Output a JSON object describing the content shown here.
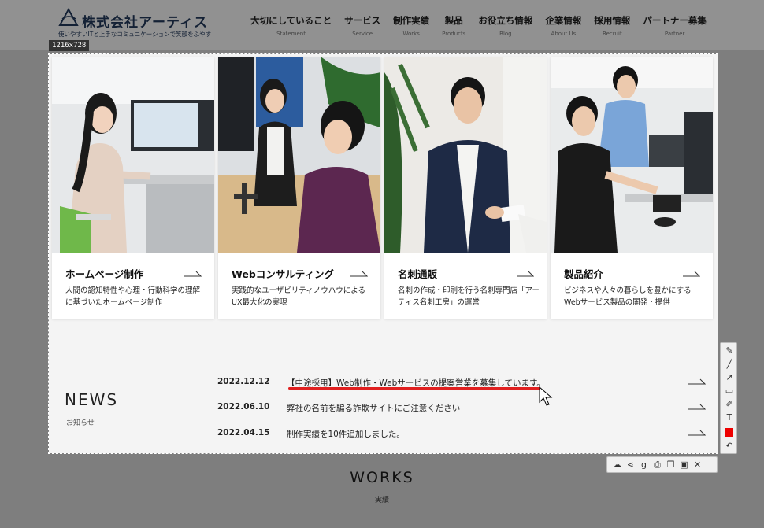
{
  "header": {
    "logo_text": "株式会社アーティス",
    "logo_tagline": "使いやすいITと上手なコミュニケーションで笑顔をふやす",
    "nav": [
      {
        "label": "大切にしていること",
        "sub": "Statement"
      },
      {
        "label": "サービス",
        "sub": "Service"
      },
      {
        "label": "制作実績",
        "sub": "Works"
      },
      {
        "label": "製品",
        "sub": "Products"
      },
      {
        "label": "お役立ち情報",
        "sub": "Blog"
      },
      {
        "label": "企業情報",
        "sub": "About Us"
      },
      {
        "label": "採用情報",
        "sub": "Recruit"
      },
      {
        "label": "パートナー募集",
        "sub": "Partner"
      }
    ]
  },
  "selection": {
    "size_label": "1216x728"
  },
  "cards": [
    {
      "title": "ホームページ制作",
      "desc": "人間の認知特性や心理・行動科学の理解に基づいたホームページ制作"
    },
    {
      "title": "Webコンサルティング",
      "desc": "実践的なユーザビリティノウハウによるUX最大化の実現"
    },
    {
      "title": "名刺通販",
      "desc": "名刺の作成・印刷を行う名刺専門店「アーティス名刺工房」の運営"
    },
    {
      "title": "製品紹介",
      "desc": "ビジネスや人々の暮らしを豊かにするWebサービス製品の開発・提供"
    }
  ],
  "news": {
    "heading": "NEWS",
    "sub": "お知らせ",
    "items": [
      {
        "date": "2022.12.12",
        "title": "【中途採用】Web制作・Webサービスの提案営業を募集しています。"
      },
      {
        "date": "2022.06.10",
        "title": "弊社の名前を騙る詐欺サイトにご注意ください"
      },
      {
        "date": "2022.04.15",
        "title": "制作実績を10件追加しました。"
      }
    ]
  },
  "works": {
    "title": "WORKS",
    "sub": "実績"
  },
  "colors": {
    "annotation_red": "#e02020",
    "logo_navy": "#233a5c"
  }
}
